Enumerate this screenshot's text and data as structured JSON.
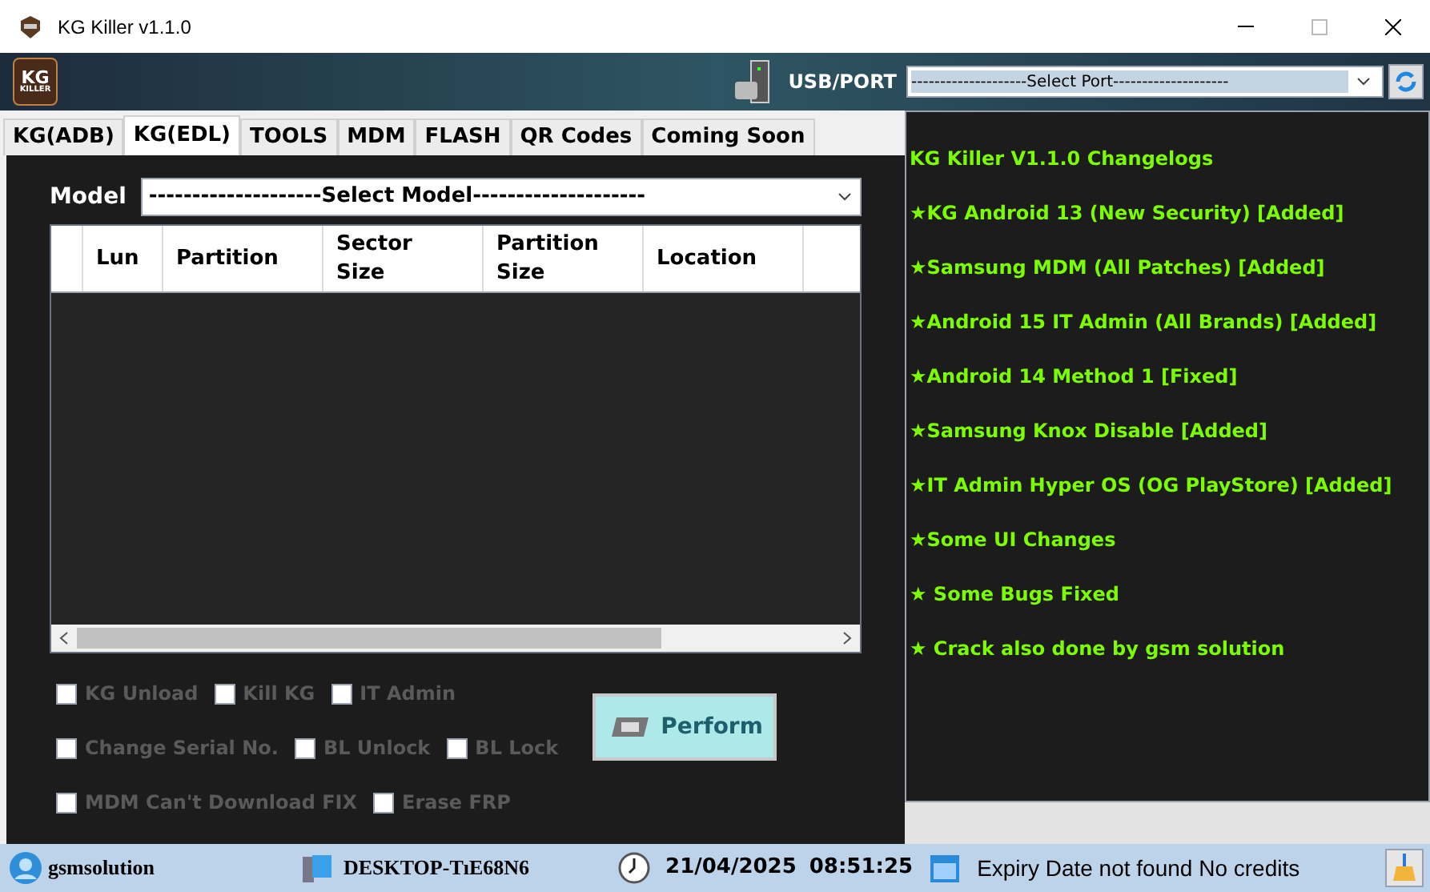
{
  "window": {
    "title": "KG Killer v1.1.0"
  },
  "header": {
    "logo_top": "KG",
    "logo_bottom": "KILLER",
    "port_label": "USB/PORT",
    "port_select": "--------------------Select Port--------------------"
  },
  "tabs": [
    {
      "label": "KG(ADB)",
      "selected": false
    },
    {
      "label": "KG(EDL)",
      "selected": true
    },
    {
      "label": "TOOLS",
      "selected": false
    },
    {
      "label": "MDM",
      "selected": false
    },
    {
      "label": "FLASH",
      "selected": false
    },
    {
      "label": "QR Codes",
      "selected": false
    },
    {
      "label": "Coming Soon",
      "selected": false
    }
  ],
  "model": {
    "label": "Model",
    "value": "--------------------Select Model--------------------"
  },
  "table": {
    "columns": [
      "Lun",
      "Partition",
      "Sector Size",
      "Partition Size",
      "Location"
    ]
  },
  "options": [
    [
      {
        "label": "KG Unload",
        "checked": false,
        "disabled": true
      },
      {
        "label": "Kill KG",
        "checked": false,
        "disabled": true
      },
      {
        "label": "IT Admin",
        "checked": false,
        "disabled": true
      }
    ],
    [
      {
        "label": "Change Serial No.",
        "checked": false,
        "disabled": true
      },
      {
        "label": "BL Unlock",
        "checked": false,
        "disabled": true
      },
      {
        "label": "BL Lock",
        "checked": false,
        "disabled": true
      }
    ],
    [
      {
        "label": "MDM Can't Download FIX",
        "checked": false,
        "disabled": true
      },
      {
        "label": "Erase FRP",
        "checked": false,
        "disabled": true
      }
    ]
  ],
  "perform_button": "Perform",
  "changelog": [
    "KG Killer V1.1.0 Changelogs",
    "★KG Android 13 (New Security) [Added]",
    "★Samsung MDM (All Patches) [Added]",
    "★Android 15 IT Admin (All Brands) [Added]",
    "★Android 14 Method 1 [Fixed]",
    "★Samsung Knox Disable [Added]",
    "★IT Admin Hyper OS (OG PlayStore) [Added]",
    "★Some UI Changes",
    "★ Some Bugs Fixed",
    "★ Crack also done by gsm solution"
  ],
  "status_bar": {
    "user": "gsmsolution",
    "computer": "DESKTOP-TıE68N6",
    "date": "21/04/2025",
    "time": "08:51:25",
    "expiry": "Expiry Date not found No credits"
  }
}
